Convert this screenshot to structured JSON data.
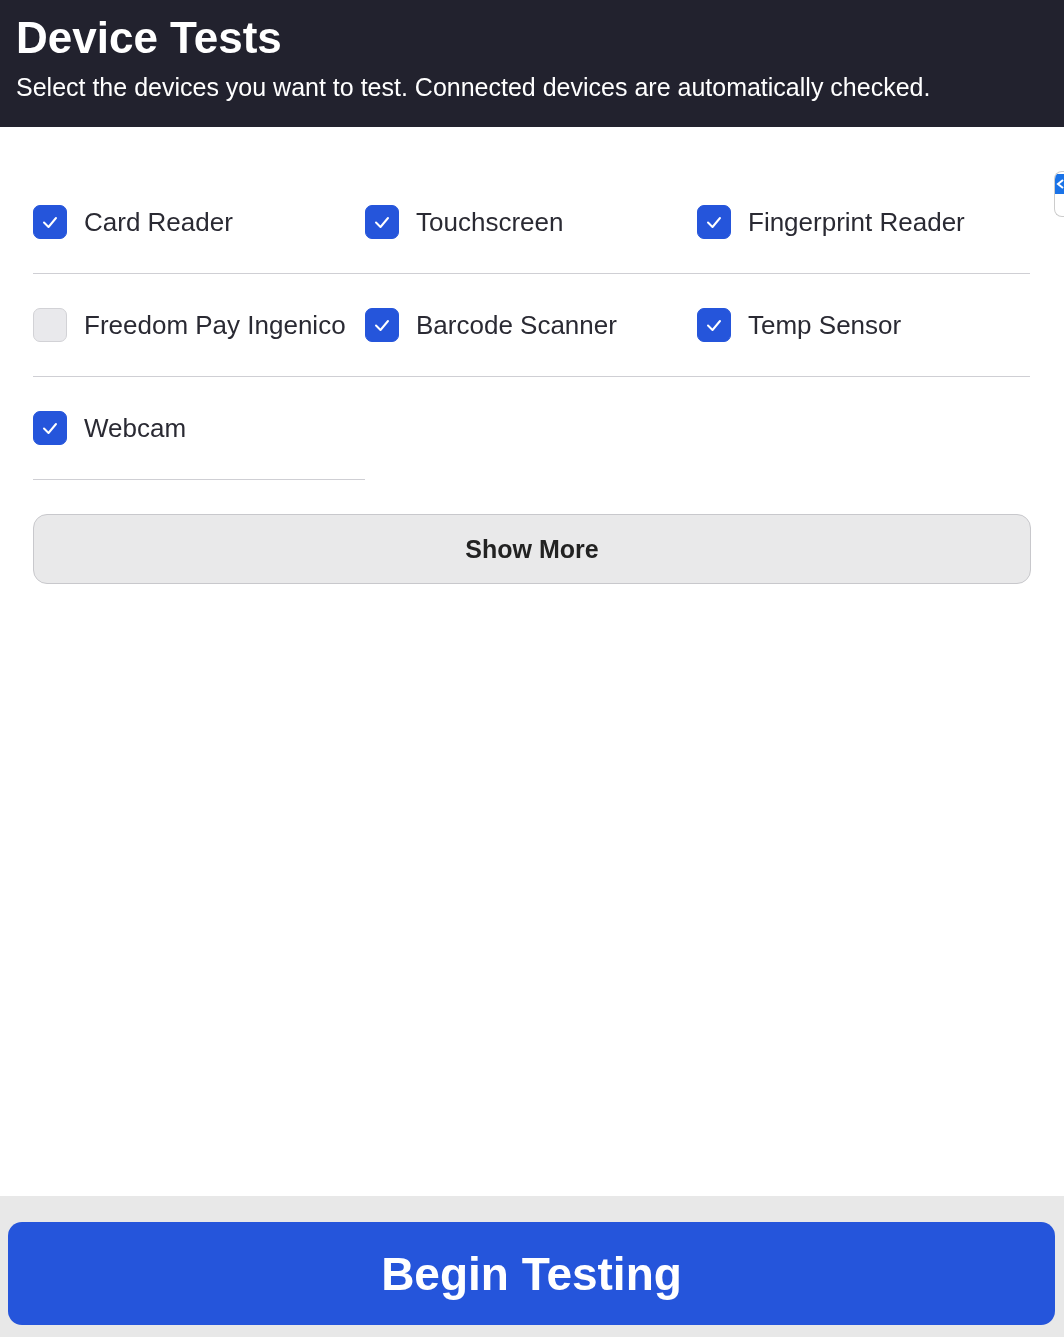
{
  "header": {
    "title": "Device Tests",
    "subtitle": "Select the devices you want to test. Connected devices are automatically checked."
  },
  "devices": [
    {
      "label": "Card Reader",
      "checked": true
    },
    {
      "label": "Touchscreen",
      "checked": true
    },
    {
      "label": "Fingerprint Reader",
      "checked": true
    },
    {
      "label": "Freedom Pay Ingenico",
      "checked": false
    },
    {
      "label": "Barcode Scanner",
      "checked": true
    },
    {
      "label": "Temp Sensor",
      "checked": true
    },
    {
      "label": "Webcam",
      "checked": true
    }
  ],
  "show_more": "Show More",
  "begin_button": "Begin Testing"
}
